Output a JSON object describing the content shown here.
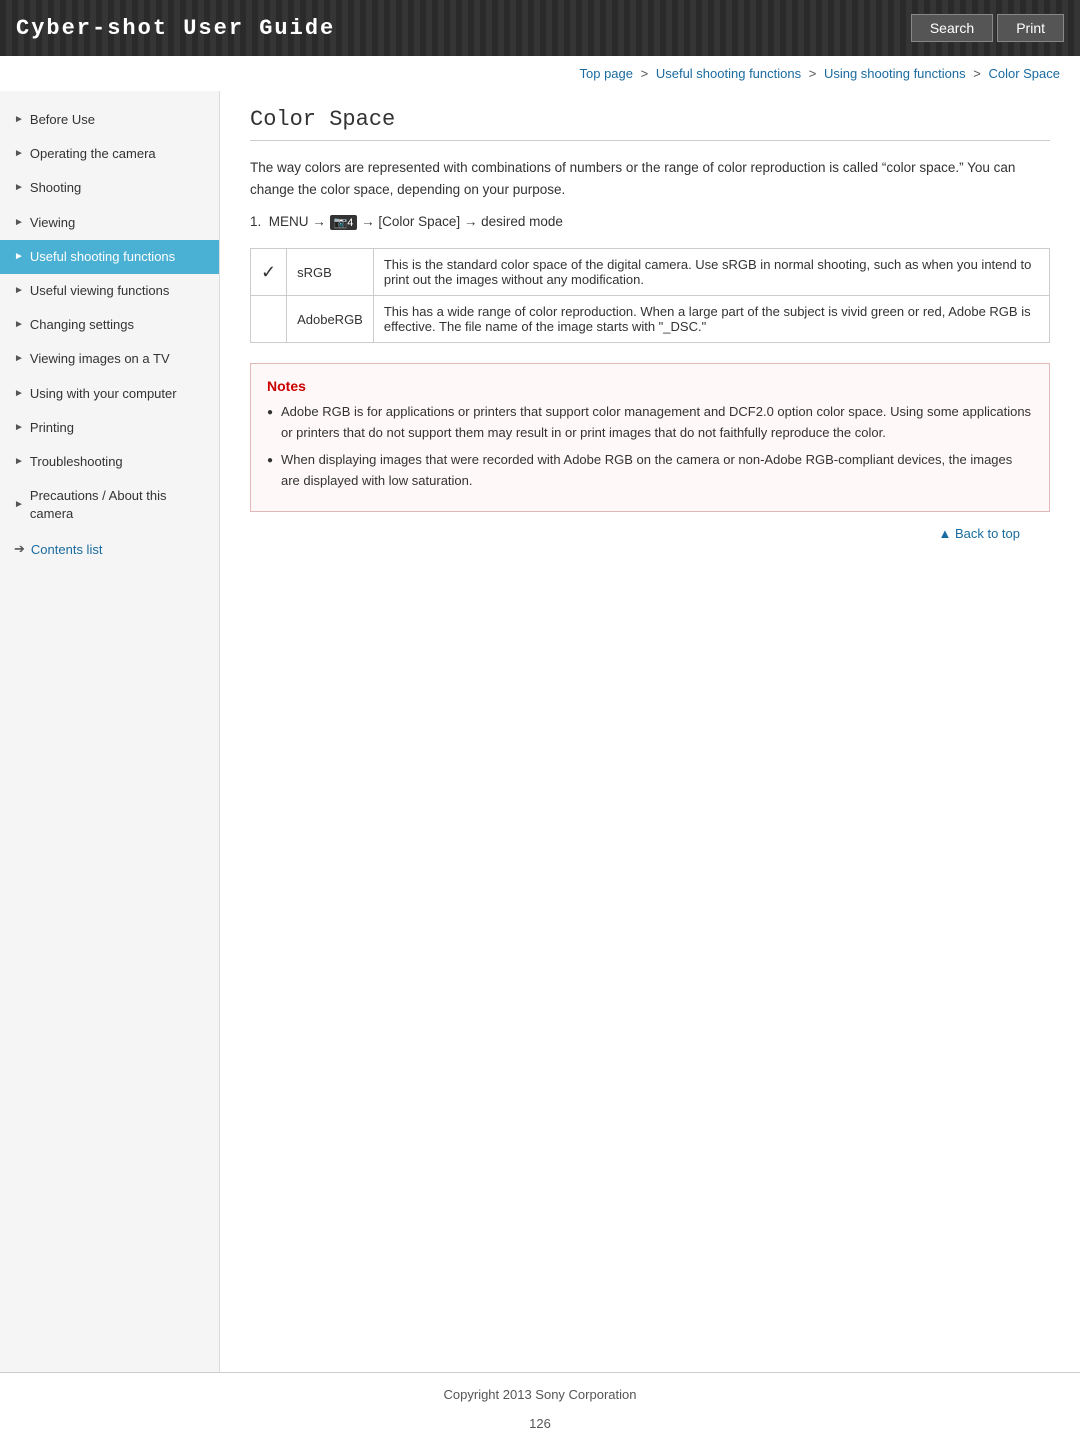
{
  "header": {
    "title": "Cyber-shot User Guide",
    "search_label": "Search",
    "print_label": "Print"
  },
  "breadcrumb": {
    "items": [
      {
        "label": "Top page",
        "href": "#"
      },
      {
        "label": "Useful shooting functions",
        "href": "#"
      },
      {
        "label": "Using shooting functions",
        "href": "#"
      },
      {
        "label": "Color Space",
        "href": "#"
      }
    ],
    "separators": [
      " > ",
      " > ",
      " > "
    ]
  },
  "sidebar": {
    "items": [
      {
        "label": "Before Use",
        "active": false
      },
      {
        "label": "Operating the camera",
        "active": false
      },
      {
        "label": "Shooting",
        "active": false
      },
      {
        "label": "Viewing",
        "active": false
      },
      {
        "label": "Useful shooting functions",
        "active": true
      },
      {
        "label": "Useful viewing functions",
        "active": false
      },
      {
        "label": "Changing settings",
        "active": false
      },
      {
        "label": "Viewing images on a TV",
        "active": false
      },
      {
        "label": "Using with your computer",
        "active": false
      },
      {
        "label": "Printing",
        "active": false
      },
      {
        "label": "Troubleshooting",
        "active": false
      },
      {
        "label": "Precautions / About this camera",
        "active": false
      }
    ],
    "contents_link": "Contents list"
  },
  "content": {
    "page_title": "Color Space",
    "intro": "The way colors are represented with combinations of numbers or the range of color reproduction is called “color space.” You can change the color space, depending on your purpose.",
    "step": "1. MENU → 📷 4 → [Color Space] → desired mode",
    "table": {
      "rows": [
        {
          "has_check": true,
          "name": "sRGB",
          "description": "This is the standard color space of the digital camera. Use sRGB in normal shooting, such as when you intend to print out the images without any modification."
        },
        {
          "has_check": false,
          "name": "AdobeRGB",
          "description": "This has a wide range of color reproduction. When a large part of the subject is vivid green or red, Adobe RGB is effective. The file name of the image starts with \"_DSC.\""
        }
      ]
    },
    "notes": {
      "title": "Notes",
      "items": [
        "Adobe RGB is for applications or printers that support color management and DCF2.0 option color space. Using some applications or printers that do not support them may result in or print images that do not faithfully reproduce the color.",
        "When displaying images that were recorded with Adobe RGB on the camera or non-Adobe RGB-compliant devices, the images are displayed with low saturation."
      ]
    }
  },
  "back_to_top": "▲ Back to top",
  "footer": {
    "copyright": "Copyright 2013 Sony Corporation",
    "page_number": "126"
  }
}
